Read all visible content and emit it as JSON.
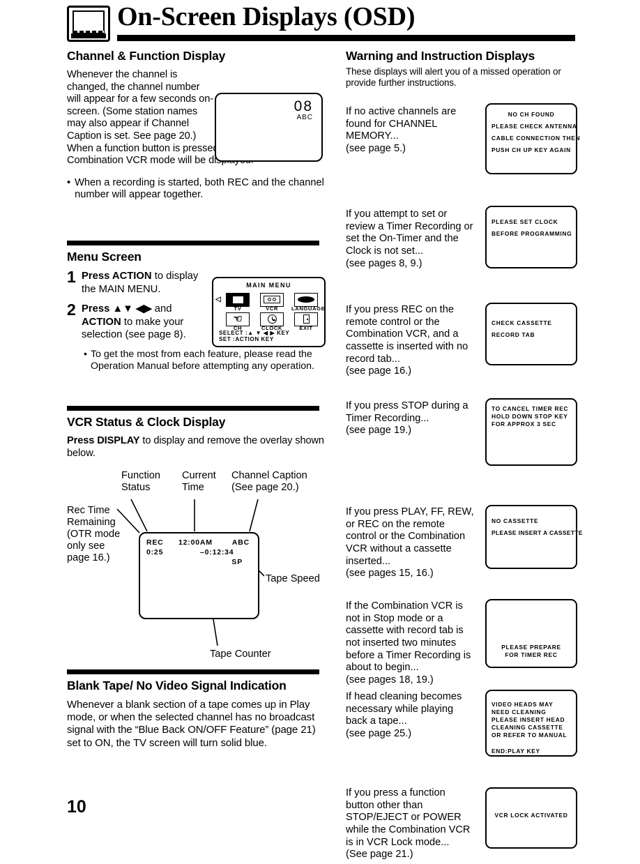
{
  "header": {
    "title": "On-Screen Displays (OSD)",
    "logo_icon": "tv-icon"
  },
  "page_number": "10",
  "left_column": {
    "channel_function": {
      "heading": "Channel & Function Display",
      "paragraph1": "Whenever the channel is changed, the channel number will appear for a few seconds on-screen. (Some station names may also appear if Channel Caption is set. See page 20.)",
      "paragraph2": "When a function button is pressed (PLAY, FF, etc.), the Combination VCR mode will be displayed.",
      "bullet": "When a recording is started, both REC and the channel number will appear together.",
      "tv_mock": {
        "channel_number": "08",
        "caption": "ABC"
      }
    },
    "menu_screen": {
      "heading": "Menu Screen",
      "step1_num": "1",
      "step1_bold": "Press ACTION",
      "step1_rest": " to display the MAIN MENU.",
      "step2_num": "2",
      "step2_bold_a": "Press",
      "step2_arrows": "▲▼ ◀▶",
      "step2_mid": " and ",
      "step2_bold_b": "ACTION",
      "step2_rest": " to make your selection (see page 8).",
      "bullet": "To get the most from each feature, please read the Operation Manual before attempting any operation.",
      "main_menu": {
        "title": "MAIN MENU",
        "cursor": "◁",
        "items": [
          {
            "label": "TV",
            "icon": "tv-icon",
            "selected": true
          },
          {
            "label": "VCR",
            "icon": "vcr-cassette-icon",
            "selected": false
          },
          {
            "label": "LANGUAGE",
            "icon": "language-icon",
            "selected": false
          },
          {
            "label": "CH",
            "icon": "antenna-icon",
            "selected": false
          },
          {
            "label": "CLOCK",
            "icon": "clock-icon",
            "selected": false
          },
          {
            "label": "EXIT",
            "icon": "exit-door-icon",
            "selected": false
          }
        ],
        "footer_line1": "SELECT :▲ ▼ ◀ ▶  KEY",
        "footer_line2": "SET      :ACTION KEY"
      }
    },
    "vcr_status": {
      "heading": "VCR Status & Clock Display",
      "instruction_bold": "Press DISPLAY",
      "instruction_rest": " to display and remove the overlay shown below.",
      "callouts": {
        "function_status": "Function\nStatus",
        "current_time": "Current\nTime",
        "channel_caption": "Channel Caption\n(See page 20.)",
        "rec_time_remaining": "Rec Time\nRemaining\n(OTR mode\nonly see\npage 16.)",
        "tape_speed": "Tape Speed",
        "tape_counter": "Tape Counter"
      },
      "overlay": {
        "function_status": "REC",
        "current_time": "12:00AM",
        "channel_caption": "ABC",
        "rec_time_remaining": "0:25",
        "tape_counter": "–0:12:34",
        "tape_speed": "SP"
      }
    },
    "blank_tape": {
      "heading": "Blank Tape/ No Video Signal Indication",
      "paragraph": "Whenever a blank section of a tape comes up in Play mode, or when the selected channel has no broadcast signal with the “Blue Back ON/OFF Feature” (page 21) set to ON, the TV screen will turn solid blue."
    }
  },
  "right_column": {
    "heading": "Warning and Instruction Displays",
    "intro": "These displays will alert you of a missed operation or provide further instructions.",
    "entries": [
      {
        "text": "If no active channels are found for CHANNEL MEMORY...\n(see page 5.)",
        "osd_lines": [
          "NO CH FOUND",
          "PLEASE CHECK ANTENNA",
          "CABLE CONNECTION THEN",
          "PUSH CH UP KEY AGAIN"
        ],
        "first_centered": true
      },
      {
        "text": "If you attempt to set or review a Timer Recording or set the On-Timer and the Clock is not set...\n(see pages 8, 9.)",
        "osd_lines": [
          "PLEASE SET CLOCK",
          "BEFORE PROGRAMMING"
        ]
      },
      {
        "text": "If you press REC on the remote control or the Combination VCR, and a cassette is inserted with no record tab...\n(see page 16.)",
        "osd_lines": [
          "CHECK CASSETTE",
          "RECORD TAB"
        ]
      },
      {
        "text": "If you press STOP during a Timer Recording...\n(see page 19.)",
        "osd_lines": [
          "TO CANCEL TIMER REC",
          "HOLD DOWN STOP KEY",
          "FOR APPROX 3 SEC"
        ],
        "tight": true
      },
      {
        "text": "If you press PLAY, FF, REW, or REC on the remote control or the Combination VCR without a cassette inserted...\n(see pages 15, 16.)",
        "osd_lines": [
          "NO CASSETTE",
          "PLEASE  INSERT A CASSETTE"
        ]
      },
      {
        "text": "If the Combination VCR is not in Stop mode or a cassette with record tab is not inserted two minutes before a Timer Recording is about to begin...\n(see pages 18, 19.)",
        "osd_lines": [
          "PLEASE PREPARE",
          "FOR TIMER REC"
        ],
        "centered": true,
        "tight": true
      },
      {
        "text": "If head cleaning becomes necessary while playing back a tape...\n(see page 25.)",
        "osd_lines": [
          "VIDEO HEADS MAY",
          "NEED CLEANING",
          "PLEASE  INSERT HEAD",
          "CLEANING CASSETTE",
          "OR REFER  TO MANUAL"
        ],
        "footer_line": "END:PLAY KEY",
        "tight": true
      },
      {
        "text": "If you press a function button other than STOP/EJECT or POWER while the Combination VCR is in VCR Lock mode...\n(See page 21.)",
        "osd_lines": [
          "VCR LOCK ACTIVATED"
        ],
        "centered": true
      }
    ]
  }
}
